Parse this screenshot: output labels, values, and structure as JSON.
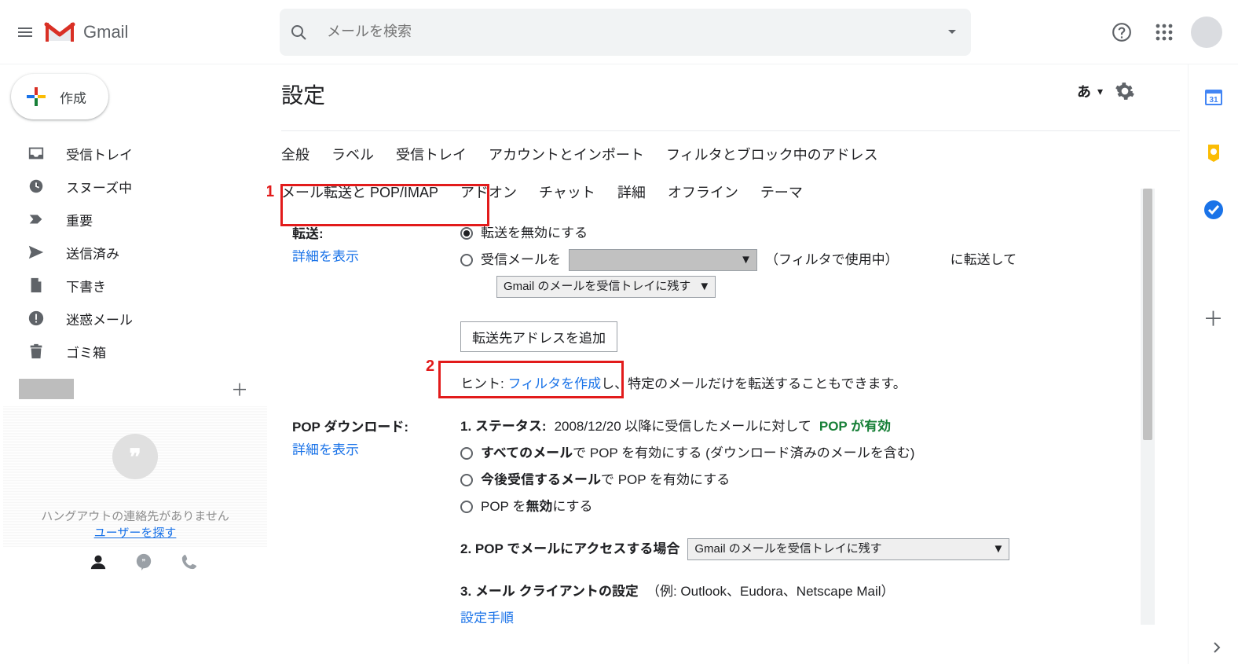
{
  "header": {
    "app_name": "Gmail",
    "search_placeholder": "メールを検索"
  },
  "sidebar": {
    "compose_label": "作成",
    "items": [
      {
        "label": "受信トレイ",
        "icon": "inbox"
      },
      {
        "label": "スヌーズ中",
        "icon": "clock"
      },
      {
        "label": "重要",
        "icon": "important"
      },
      {
        "label": "送信済み",
        "icon": "sent"
      },
      {
        "label": "下書き",
        "icon": "draft"
      },
      {
        "label": "迷惑メール",
        "icon": "spam"
      },
      {
        "label": "ゴミ箱",
        "icon": "trash"
      }
    ],
    "hangouts_empty_line1": "ハングアウトの連絡先がありません",
    "hangouts_empty_line2": "ユーザーを探す"
  },
  "settings": {
    "title": "設定",
    "language_indicator": "あ",
    "tabs": [
      "全般",
      "ラベル",
      "受信トレイ",
      "アカウントとインポート",
      "フィルタとブロック中のアドレス"
    ],
    "tabs2": [
      "メール転送と POP/IMAP",
      "アドオン",
      "チャット",
      "詳細",
      "オフライン",
      "テーマ"
    ],
    "active_tab": "メール転送と POP/IMAP",
    "annotations": {
      "label1": "1",
      "label2": "2"
    },
    "forwarding": {
      "section_label": "転送:",
      "detail_link": "詳細を表示",
      "opt_disable": "転送を無効にする",
      "opt_forward_prefix": "受信メールを",
      "opt_forward_mid": "（フィルタで使用中）",
      "opt_forward_suffix": "に転送して",
      "dropdown_keep": "Gmail のメールを受信トレイに残す",
      "add_address_btn": "転送先アドレスを追加",
      "hint_prefix": "ヒント: ",
      "hint_link": "フィルタを作成",
      "hint_suffix": "し、特定のメールだけを転送することもできます。"
    },
    "pop": {
      "section_label": "POP ダウンロード:",
      "detail_link": "詳細を表示",
      "status_label": "1. ステータス:",
      "status_text": " 2008/12/20 以降に受信したメールに対して ",
      "status_badge": "POP が有効",
      "opt_all_prefix": "すべてのメール",
      "opt_all_suffix": "で POP を有効にする (ダウンロード済みのメールを含む)",
      "opt_future_prefix": "今後受信するメール",
      "opt_future_suffix": "で POP を有効にする",
      "opt_disable_prefix": "POP を",
      "opt_disable_mid": "無効",
      "opt_disable_suffix": "にする",
      "access_label": "2. POP でメールにアクセスする場合",
      "access_dropdown": "Gmail のメールを受信トレイに残す",
      "client_label": "3. メール クライアントの設定",
      "client_example": "（例: Outlook、Eudora、Netscape Mail）",
      "client_link": "設定手順"
    }
  },
  "rightrail": {
    "calendar_day": "31"
  }
}
